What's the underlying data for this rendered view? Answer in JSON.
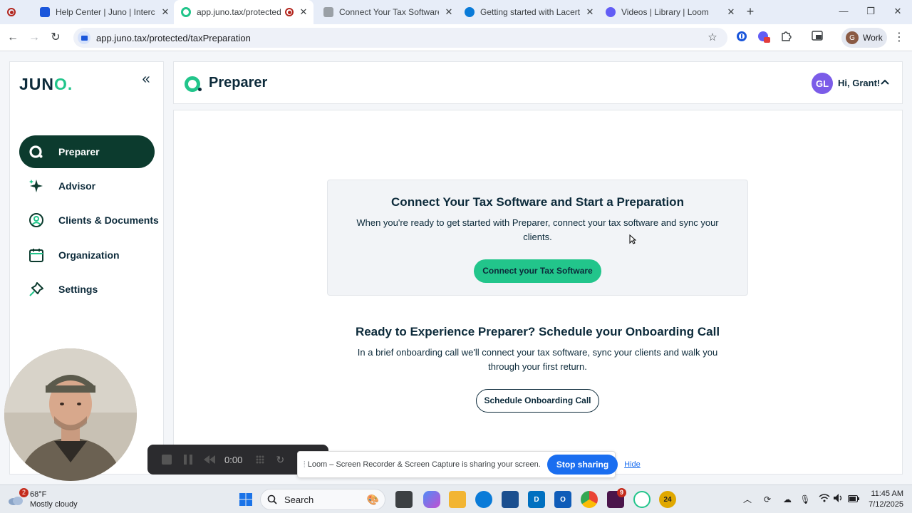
{
  "browser": {
    "tabs": [
      {
        "title": "Help Center | Juno | Intercom",
        "active": false
      },
      {
        "title": "app.juno.tax/protected/taxPr",
        "active": true
      },
      {
        "title": "Connect Your Tax Software to Ju",
        "active": false
      },
      {
        "title": "Getting started with Lacerte SD",
        "active": false
      },
      {
        "title": "Videos | Library | Loom",
        "active": false
      }
    ],
    "url": "app.juno.tax/protected/taxPreparation",
    "profile_label": "Work",
    "profile_initial": "G"
  },
  "sidebar": {
    "logo_text": "JUN",
    "logo_o": "O.",
    "items": [
      {
        "label": "Preparer",
        "icon": "preparer-icon",
        "active": true
      },
      {
        "label": "Advisor",
        "icon": "sparkle-icon",
        "active": false
      },
      {
        "label": "Clients & Documents",
        "icon": "user-circle-icon",
        "active": false
      },
      {
        "label": "Organization",
        "icon": "calendar-icon",
        "active": false
      },
      {
        "label": "Settings",
        "icon": "pin-icon",
        "active": false
      }
    ]
  },
  "header": {
    "title": "Preparer",
    "user_initials": "GL",
    "greeting": "Hi, Grant!"
  },
  "main": {
    "connect_card": {
      "heading": "Connect Your Tax Software and Start a Preparation",
      "body": "When you're ready to get started with Preparer, connect your tax software and sync your clients.",
      "button": "Connect your Tax Software"
    },
    "onboarding": {
      "heading": "Ready to Experience Preparer? Schedule your Onboarding Call",
      "body": "In a brief onboarding call we'll connect your tax software, sync your clients and walk you through your first return.",
      "button": "Schedule Onboarding Call"
    }
  },
  "loom": {
    "timer": "0:00",
    "share_text": "Loom – Screen Recorder & Screen Capture is sharing your screen.",
    "stop_button": "Stop sharing",
    "hide_link": "Hide"
  },
  "taskbar": {
    "weather_badge": "2",
    "temperature": "68°F",
    "weather_desc": "Mostly cloudy",
    "search_label": "Search",
    "app_badge": "9",
    "time": "11:45 AM",
    "date": "7/12/2025",
    "extra_badge": "24"
  },
  "colors": {
    "brand_green": "#22c58b",
    "brand_dark": "#0c3b2e",
    "text_dark": "#0c2a3a",
    "avatar_purple": "#7b5ce8",
    "loom_blue": "#1a6ef0"
  }
}
